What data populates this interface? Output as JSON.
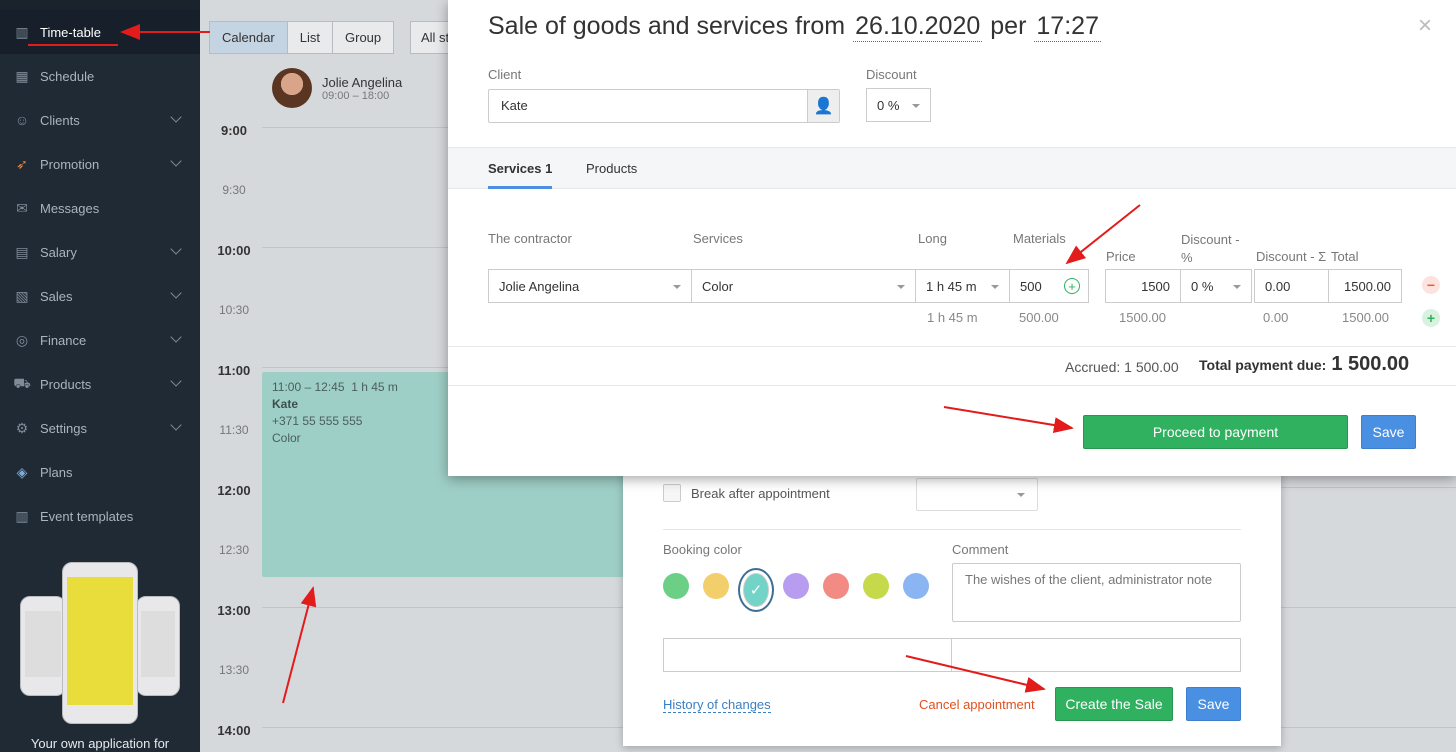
{
  "sidebar": {
    "items": [
      {
        "label": "Time-table",
        "icon": "book-icon"
      },
      {
        "label": "Schedule",
        "icon": "calendar-icon"
      },
      {
        "label": "Clients",
        "icon": "users-icon"
      },
      {
        "label": "Promotion",
        "icon": "rocket-icon"
      },
      {
        "label": "Messages",
        "icon": "chat-icon"
      },
      {
        "label": "Salary",
        "icon": "calculator-icon"
      },
      {
        "label": "Sales",
        "icon": "receipt-icon"
      },
      {
        "label": "Finance",
        "icon": "coins-icon"
      },
      {
        "label": "Products",
        "icon": "cart-icon"
      },
      {
        "label": "Settings",
        "icon": "gear-icon"
      },
      {
        "label": "Plans",
        "icon": "layers-icon"
      },
      {
        "label": "Event templates",
        "icon": "book-icon"
      }
    ],
    "app_promo": "Your own application for"
  },
  "calendar": {
    "views": [
      "Calendar",
      "List",
      "Group",
      "All st"
    ],
    "staff": {
      "name": "Jolie Angelina",
      "hours": "09:00 – 18:00"
    },
    "times": [
      "9:00",
      "9:30",
      "10:00",
      "10:30",
      "11:00",
      "11:30",
      "12:00",
      "12:30",
      "13:00",
      "13:30",
      "14:00"
    ],
    "appointment": {
      "time": "11:00 – 12:45",
      "duration": "1 h 45 m",
      "client": "Kate",
      "phone": "+371 55 555 555",
      "service": "Color"
    }
  },
  "booking": {
    "break_label": "Break after appointment",
    "color_label": "Booking color",
    "comment_label": "Comment",
    "comment_placeholder": "The wishes of the client, administrator note",
    "colors": [
      "#6ccf86",
      "#f2cf6b",
      "#72d3c7",
      "#b89cf0",
      "#f28b84",
      "#c5d94a",
      "#8ab4f2"
    ],
    "history_link": "History of changes",
    "cancel_link": "Cancel appointment",
    "create_sale": "Create the Sale",
    "save": "Save"
  },
  "sale": {
    "title_prefix": "Sale of goods and services from",
    "date": "26.10.2020",
    "per": "per",
    "time": "17:27",
    "close": "×",
    "client_label": "Client",
    "client_value": "Kate",
    "discount_label": "Discount",
    "discount_value": "0 %",
    "tabs": [
      "Services 1",
      "Products"
    ],
    "columns": {
      "contractor": "The contractor",
      "services": "Services",
      "long": "Long",
      "materials": "Materials",
      "price": "Price",
      "discount_pct": "Discount - %",
      "discount_sum": "Discount - Σ",
      "total": "Total"
    },
    "row": {
      "contractor": "Jolie Angelina",
      "service": "Color",
      "long": "1 h 45 m",
      "materials": "500",
      "price": "1500",
      "discount_pct": "0 %",
      "discount_sum": "0.00",
      "total": "1500.00"
    },
    "subtotals": {
      "long": "1 h 45 m",
      "materials": "500.00",
      "price": "1500.00",
      "discount_sum": "0.00",
      "total": "1500.00"
    },
    "accrued": "Accrued: 1 500.00",
    "total_due_label": "Total payment due:",
    "total_due_value": "1 500.00",
    "proceed": "Proceed to payment",
    "save": "Save"
  },
  "colors": {
    "sidebar_bg": "#1f2a35",
    "green": "#2fb15f",
    "blue": "#4a90e2",
    "annotation_red": "#e21b1b"
  }
}
